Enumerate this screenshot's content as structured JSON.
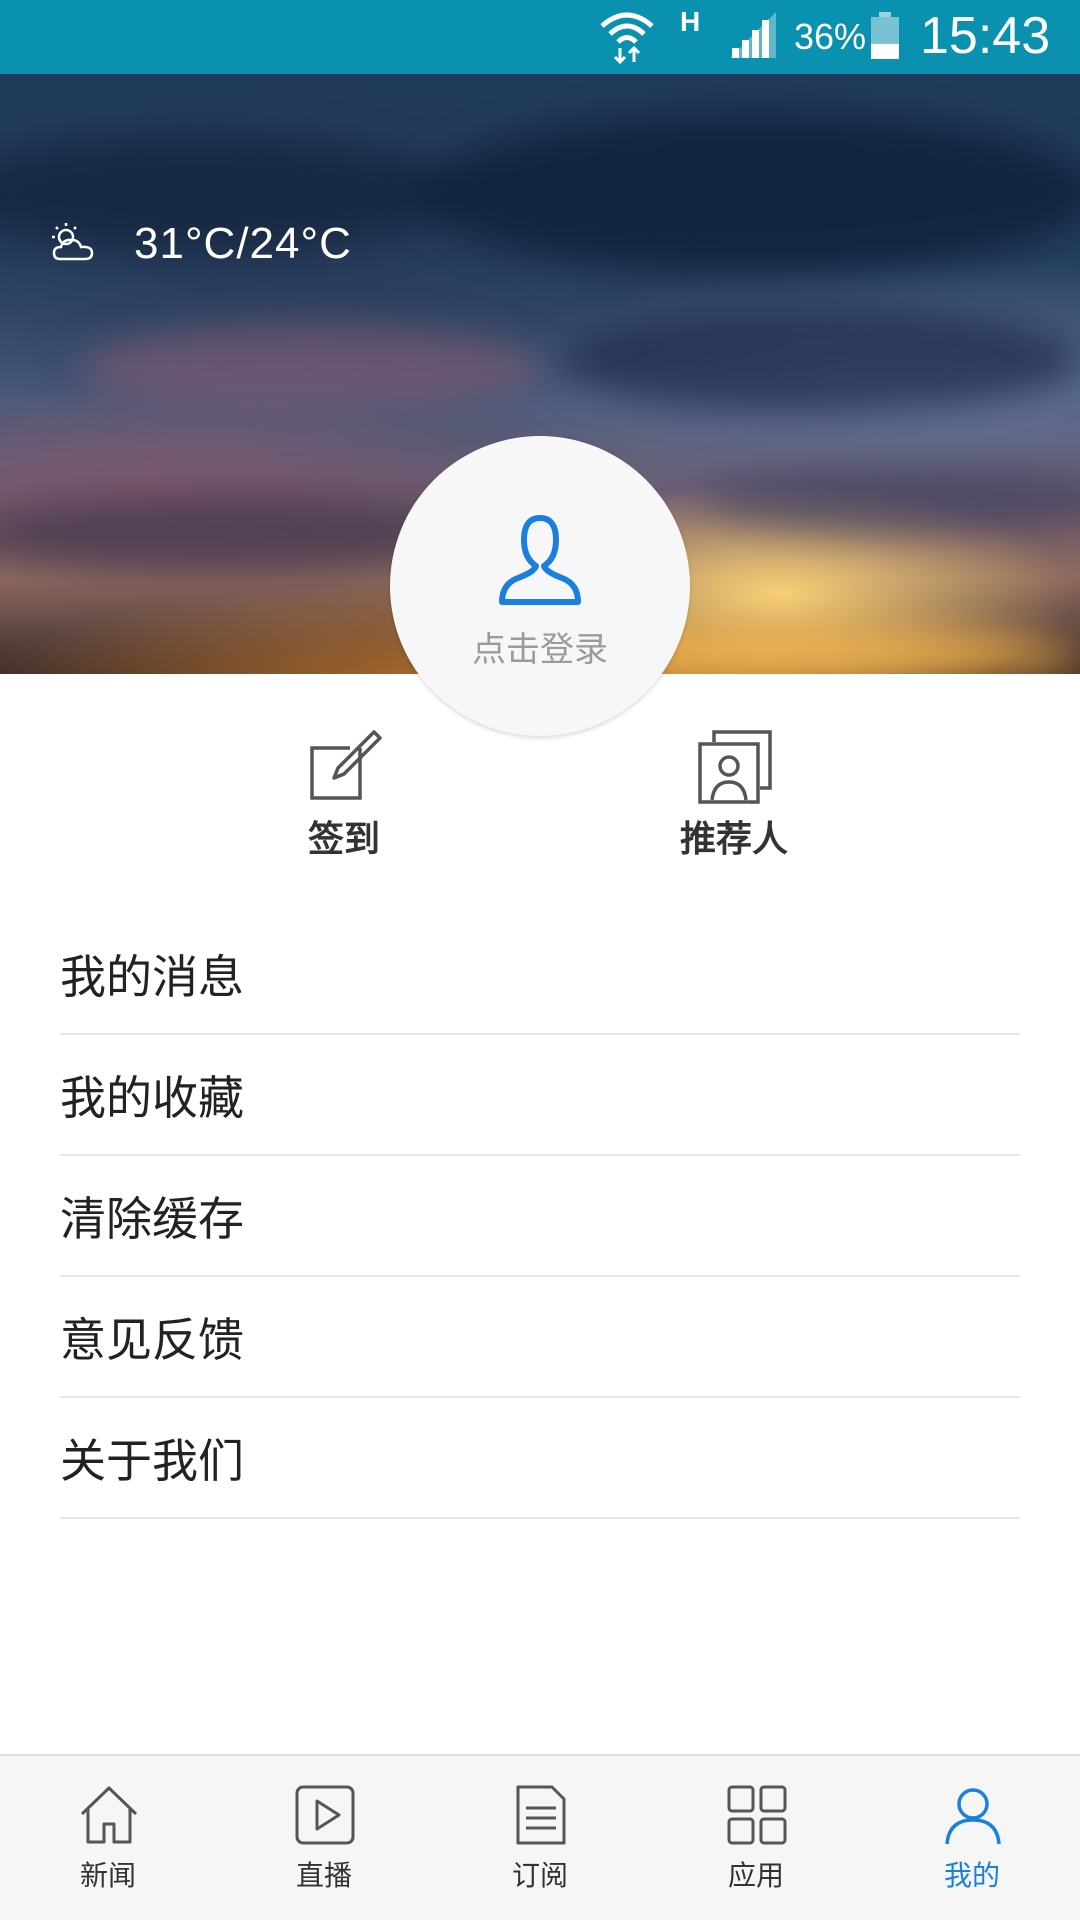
{
  "status_bar": {
    "network_type": "H",
    "battery_percent": "36%",
    "battery_level": 0.36,
    "time": "15:43"
  },
  "header": {
    "weather": {
      "icon": "partly-cloudy-icon",
      "temperature": "31°C/24°C"
    }
  },
  "profile": {
    "avatar_icon": "user-icon",
    "login_label": "点击登录"
  },
  "actions": [
    {
      "icon": "edit-icon",
      "label": "签到"
    },
    {
      "icon": "contacts-icon",
      "label": "推荐人"
    }
  ],
  "menu": [
    {
      "label": "我的消息"
    },
    {
      "label": "我的收藏"
    },
    {
      "label": "清除缓存"
    },
    {
      "label": "意见反馈"
    },
    {
      "label": "关于我们"
    }
  ],
  "bottom_nav": {
    "active_color": "#1a7fdf",
    "items": [
      {
        "icon": "home-icon",
        "label": "新闻",
        "active": false
      },
      {
        "icon": "play-icon",
        "label": "直播",
        "active": false
      },
      {
        "icon": "document-icon",
        "label": "订阅",
        "active": false
      },
      {
        "icon": "grid-icon",
        "label": "应用",
        "active": false
      },
      {
        "icon": "user-icon",
        "label": "我的",
        "active": true
      }
    ]
  },
  "colors": {
    "status_bar": "#0a91b0",
    "accent": "#1a7fdf",
    "text_primary": "#222222",
    "text_secondary": "#9b9b9b"
  }
}
